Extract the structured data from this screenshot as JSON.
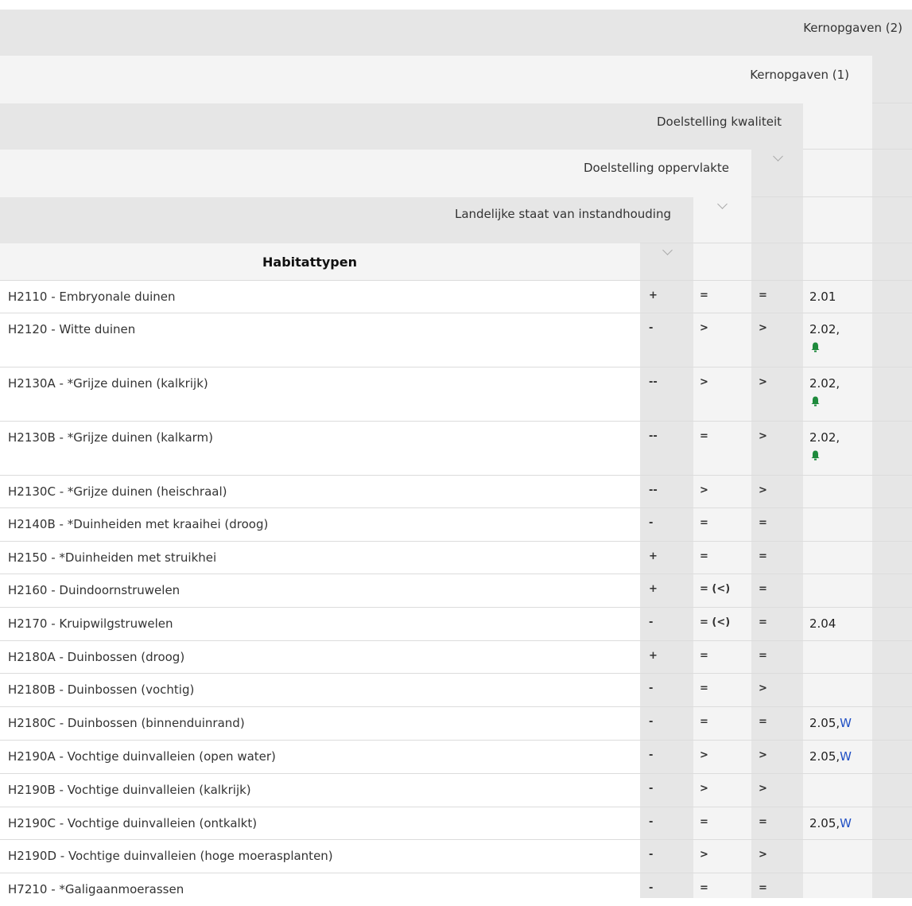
{
  "headers": {
    "kernopgaven_2": "Kernopgaven (2)",
    "kernopgaven_1": "Kernopgaven (1)",
    "doelstelling_kwaliteit": "Doelstelling kwaliteit",
    "doelstelling_oppervlakte": "Doelstelling oppervlakte",
    "landelijke_staat": "Landelijke staat van instandhouding",
    "habitattypen": "Habitattypen"
  },
  "rows": [
    {
      "habitat": "H2110 - Embryonale duinen",
      "staat": "+",
      "opp": "=",
      "kwal": "=",
      "kern_num": "2.01",
      "kern_w": "",
      "bell": false
    },
    {
      "habitat": "H2120 - Witte duinen",
      "staat": "-",
      "opp": ">",
      "kwal": ">",
      "kern_num": "2.02,",
      "kern_w": "",
      "bell": true
    },
    {
      "habitat": "H2130A - *Grijze duinen (kalkrijk)",
      "staat": "--",
      "opp": ">",
      "kwal": ">",
      "kern_num": "2.02,",
      "kern_w": "",
      "bell": true
    },
    {
      "habitat": "H2130B - *Grijze duinen (kalkarm)",
      "staat": "--",
      "opp": "=",
      "kwal": ">",
      "kern_num": "2.02,",
      "kern_w": "",
      "bell": true
    },
    {
      "habitat": "H2130C - *Grijze duinen (heischraal)",
      "staat": "--",
      "opp": ">",
      "kwal": ">",
      "kern_num": "",
      "kern_w": "",
      "bell": false
    },
    {
      "habitat": "H2140B - *Duinheiden met kraaihei (droog)",
      "staat": "-",
      "opp": "=",
      "kwal": "=",
      "kern_num": "",
      "kern_w": "",
      "bell": false
    },
    {
      "habitat": "H2150 - *Duinheiden met struikhei",
      "staat": "+",
      "opp": "=",
      "kwal": "=",
      "kern_num": "",
      "kern_w": "",
      "bell": false
    },
    {
      "habitat": "H2160 - Duindoornstruwelen",
      "staat": "+",
      "opp": "= (<)",
      "kwal": "=",
      "kern_num": "",
      "kern_w": "",
      "bell": false
    },
    {
      "habitat": "H2170 - Kruipwilgstruwelen",
      "staat": "-",
      "opp": "= (<)",
      "kwal": "=",
      "kern_num": "2.04",
      "kern_w": "",
      "bell": false
    },
    {
      "habitat": "H2180A - Duinbossen (droog)",
      "staat": "+",
      "opp": "=",
      "kwal": "=",
      "kern_num": "",
      "kern_w": "",
      "bell": false
    },
    {
      "habitat": "H2180B - Duinbossen (vochtig)",
      "staat": "-",
      "opp": "=",
      "kwal": ">",
      "kern_num": "",
      "kern_w": "",
      "bell": false
    },
    {
      "habitat": "H2180C - Duinbossen (binnenduinrand)",
      "staat": "-",
      "opp": "=",
      "kwal": "=",
      "kern_num": "2.05,",
      "kern_w": "W",
      "bell": false
    },
    {
      "habitat": "H2190A - Vochtige duinvalleien (open water)",
      "staat": "-",
      "opp": ">",
      "kwal": ">",
      "kern_num": "2.05,",
      "kern_w": "W",
      "bell": false
    },
    {
      "habitat": "H2190B - Vochtige duinvalleien (kalkrijk)",
      "staat": "-",
      "opp": ">",
      "kwal": ">",
      "kern_num": "",
      "kern_w": "",
      "bell": false
    },
    {
      "habitat": "H2190C - Vochtige duinvalleien (ontkalkt)",
      "staat": "-",
      "opp": "=",
      "kwal": "=",
      "kern_num": "2.05,",
      "kern_w": "W",
      "bell": false
    },
    {
      "habitat": "H2190D - Vochtige duinvalleien (hoge moerasplanten)",
      "staat": "-",
      "opp": ">",
      "kwal": ">",
      "kern_num": "",
      "kern_w": "",
      "bell": false
    },
    {
      "habitat": "H7210 - *Galigaanmoerassen",
      "staat": "-",
      "opp": "=",
      "kwal": "=",
      "kern_num": "",
      "kern_w": "",
      "bell": false
    }
  ],
  "colors": {
    "bell": "#1e8a3c",
    "w_link": "#1f4fc4"
  }
}
